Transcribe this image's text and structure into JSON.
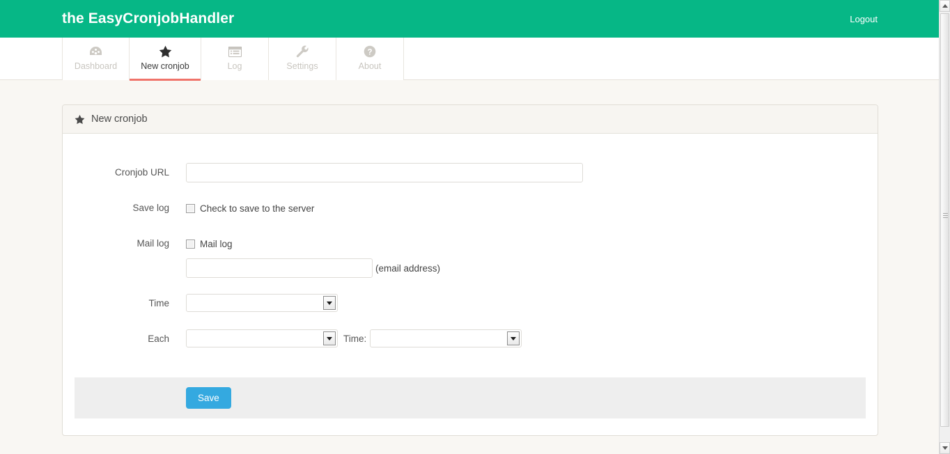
{
  "header": {
    "title": "the EasyCronjobHandler",
    "logout_label": "Logout",
    "brand_color": "#06b786"
  },
  "nav": {
    "tabs": [
      {
        "label": "Dashboard",
        "icon": "dashboard-icon",
        "active": false
      },
      {
        "label": "New cronjob",
        "icon": "star-icon",
        "active": true
      },
      {
        "label": "Log",
        "icon": "list-icon",
        "active": false
      },
      {
        "label": "Settings",
        "icon": "wrench-icon",
        "active": false
      },
      {
        "label": "About",
        "icon": "question-circle-icon",
        "active": false
      }
    ],
    "active_underline_color": "#f0736a"
  },
  "panel": {
    "heading": "New cronjob",
    "heading_icon": "star-icon"
  },
  "form": {
    "cronjob_url": {
      "label": "Cronjob URL",
      "value": "",
      "placeholder": ""
    },
    "save_log": {
      "label": "Save log",
      "checkbox_label": "Check to save to the server",
      "checked": false
    },
    "mail_log": {
      "label": "Mail log",
      "checkbox_label": "Mail log",
      "checked": false,
      "email_value": "",
      "email_placeholder": "",
      "email_hint": "(email address)"
    },
    "time": {
      "label": "Time",
      "selected": ""
    },
    "each": {
      "label": "Each",
      "selected": "",
      "time_label": "Time:",
      "time_selected": ""
    }
  },
  "footer": {
    "save_label": "Save",
    "save_color": "#34a9e0"
  }
}
